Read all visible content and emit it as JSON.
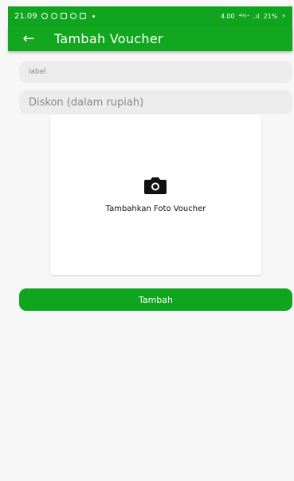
{
  "status_bar": {
    "time": "21.09",
    "speed": "4.00",
    "signal_text": "⁴⁶ᵍ⁺ ..ıl",
    "battery": "21%"
  },
  "app_bar": {
    "title": "Tambah Voucher",
    "back_icon": "arrow-left-icon"
  },
  "form": {
    "label_placeholder": "label",
    "discount_placeholder": "Diskon (dalam rupiah)",
    "photo": {
      "icon": "camera-icon",
      "label": "Tambahkan Foto Voucher"
    },
    "submit_label": "Tambah"
  },
  "colors": {
    "primary": "#12a71f",
    "background": "#f7f7f7"
  }
}
